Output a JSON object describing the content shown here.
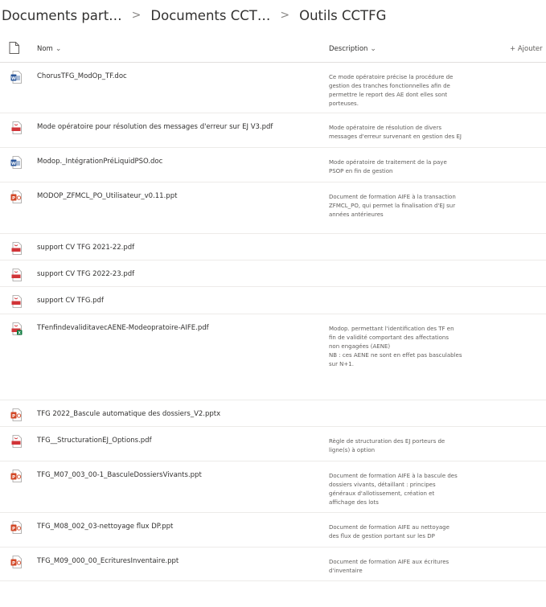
{
  "breadcrumb": {
    "items": [
      "Documents part…",
      "Documents CCT…",
      "Outils CCTFG"
    ],
    "separator": ">"
  },
  "columns": {
    "name": "Nom",
    "description": "Description",
    "add": "+ Ajouter"
  },
  "colors": {
    "word": "#2b579a",
    "pdf": "#d13438",
    "powerpoint": "#d24726",
    "excel_badge": "#107c41"
  },
  "files": [
    {
      "name": "ChorusTFG_ModOp_TF.doc",
      "type": "word",
      "description": [
        "Ce mode opératoire précise la procédure de",
        "gestion des tranches fonctionnelles afin de",
        "permettre le report des AE dont elles sont",
        "porteuses."
      ]
    },
    {
      "name": "Mode opératoire pour résolution des messages d'erreur sur EJ V3.pdf",
      "type": "pdf",
      "description": [
        "Mode opératoire de résolution de divers",
        "messages d'erreur survenant en gestion des EJ"
      ]
    },
    {
      "name": "Modop._IntégrationPréLiquidPSO.doc",
      "type": "word",
      "description": [
        "Mode opératoire de traitement de la paye",
        "PSOP en fin de gestion"
      ]
    },
    {
      "name": "MODOP_ZFMCL_PO_Utilisateur_v0.11.ppt",
      "type": "powerpoint",
      "description": [
        "Document de formation AIFE à la transaction",
        "ZFMCL_PO, qui permet la finalisation d'EJ sur",
        "années antérieures"
      ]
    },
    {
      "name": "support CV TFG 2021-22.pdf",
      "type": "pdf",
      "description": []
    },
    {
      "name": "support CV TFG 2022-23.pdf",
      "type": "pdf",
      "description": []
    },
    {
      "name": "support CV TFG.pdf",
      "type": "pdf",
      "description": []
    },
    {
      "name": "TFenfindevaliditavecAENE-Modeopratoire-AIFE.pdf",
      "type": "pdf-excel",
      "description": [
        "Modop. permettant l'identification des TF en",
        "fin de validité comportant des affectations",
        "non engagées (AENE)",
        "NB : ces AENE ne sont en effet pas basculables",
        "sur N+1."
      ]
    },
    {
      "name": "TFG 2022_Bascule automatique des dossiers_V2.pptx",
      "type": "powerpoint",
      "description": []
    },
    {
      "name": "TFG__StructurationEJ_Options.pdf",
      "type": "pdf",
      "description": [
        "Règle de structuration des EJ porteurs de",
        "ligne(s) à option"
      ]
    },
    {
      "name": "TFG_M07_003_00-1_BasculeDossiersVivants.ppt",
      "type": "powerpoint",
      "description": [
        "Document de formation AIFE à la bascule des",
        "dossiers vivants, détaillant : principes",
        "généraux d'allotissement, création et",
        "affichage des lots"
      ]
    },
    {
      "name": "TFG_M08_002_03-nettoyage flux DP.ppt",
      "type": "powerpoint",
      "description": [
        "Document de formation AIFE au nettoyage",
        "des flux de gestion portant sur les DP"
      ]
    },
    {
      "name": "TFG_M09_000_00_EcrituresInventaire.ppt",
      "type": "powerpoint",
      "description": [
        "Document de formation AIFE aux écritures",
        "d'inventaire"
      ]
    }
  ]
}
